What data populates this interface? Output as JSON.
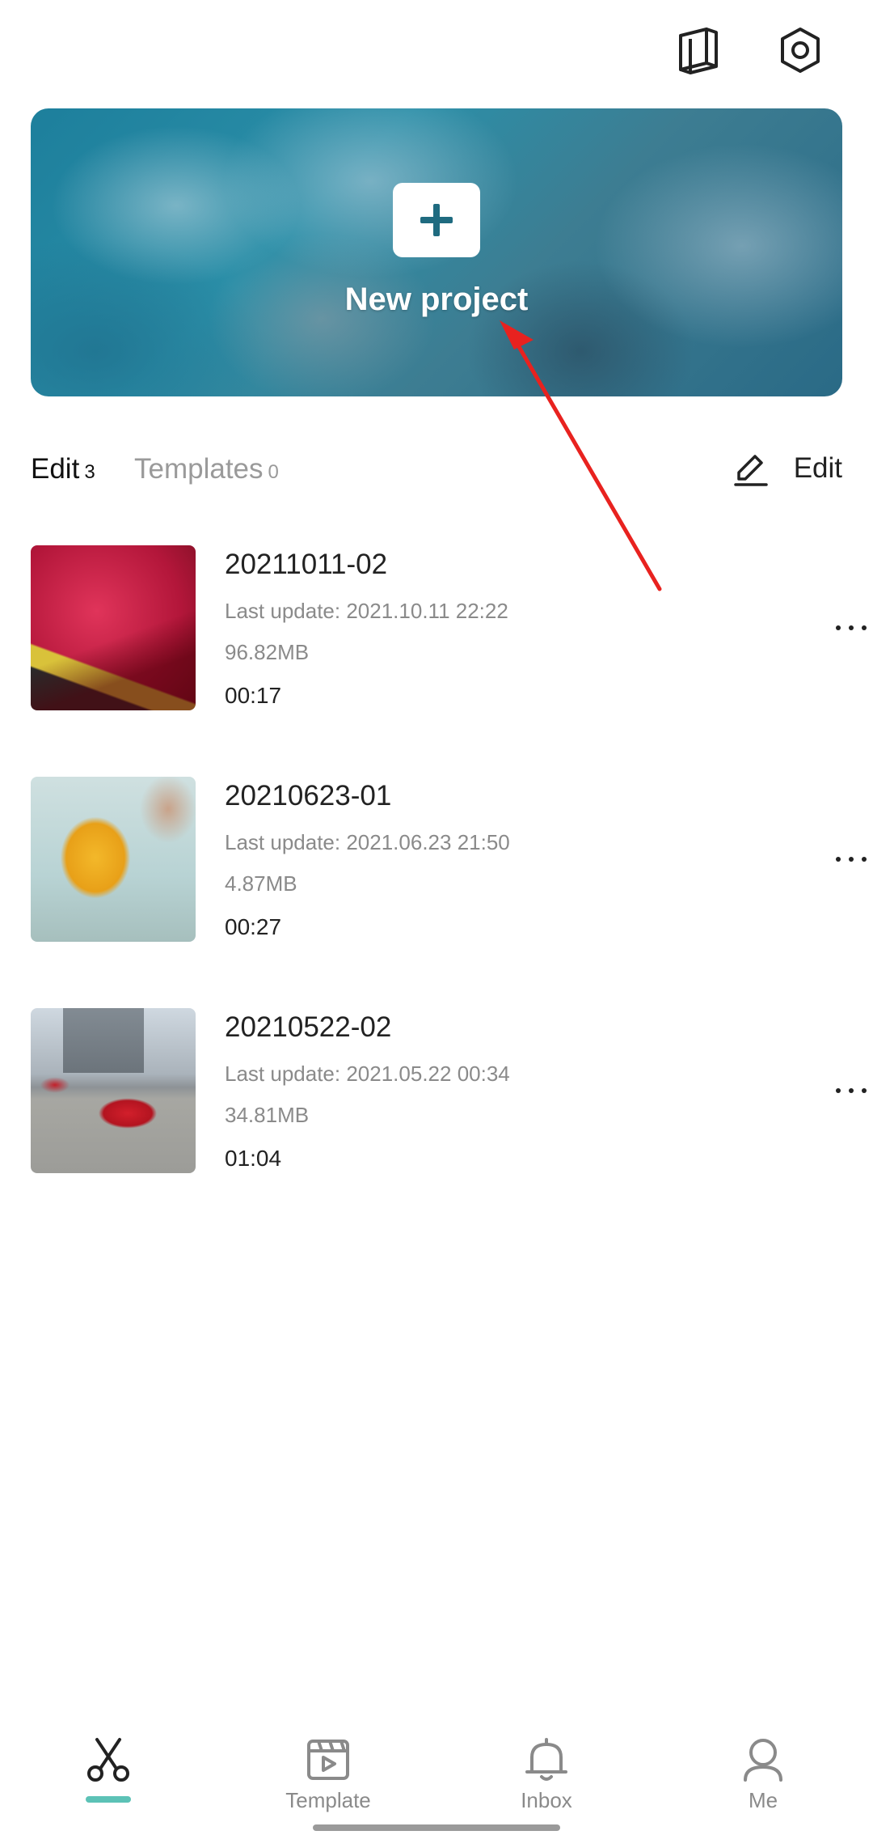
{
  "hero": {
    "label": "New project"
  },
  "tabs": [
    {
      "label": "Edit",
      "count": "3"
    },
    {
      "label": "Templates",
      "count": "0"
    }
  ],
  "edit_action": {
    "label": "Edit"
  },
  "projects": [
    {
      "title": "20211011-02",
      "updated": "Last update: 2021.10.11 22:22",
      "size": "96.82MB",
      "duration": "00:17"
    },
    {
      "title": "20210623-01",
      "updated": "Last update: 2021.06.23 21:50",
      "size": "4.87MB",
      "duration": "00:27"
    },
    {
      "title": "20210522-02",
      "updated": "Last update: 2021.05.22 00:34",
      "size": "34.81MB",
      "duration": "01:04"
    }
  ],
  "nav": [
    {
      "label": "",
      "icon": "scissors-icon",
      "active": true
    },
    {
      "label": "Template",
      "icon": "template-icon"
    },
    {
      "label": "Inbox",
      "icon": "bell-icon"
    },
    {
      "label": "Me",
      "icon": "person-icon"
    }
  ],
  "colors": {
    "accent": "#5cc2b6",
    "hero_plus": "#1f6b80",
    "annotation_arrow": "#e8221f"
  }
}
